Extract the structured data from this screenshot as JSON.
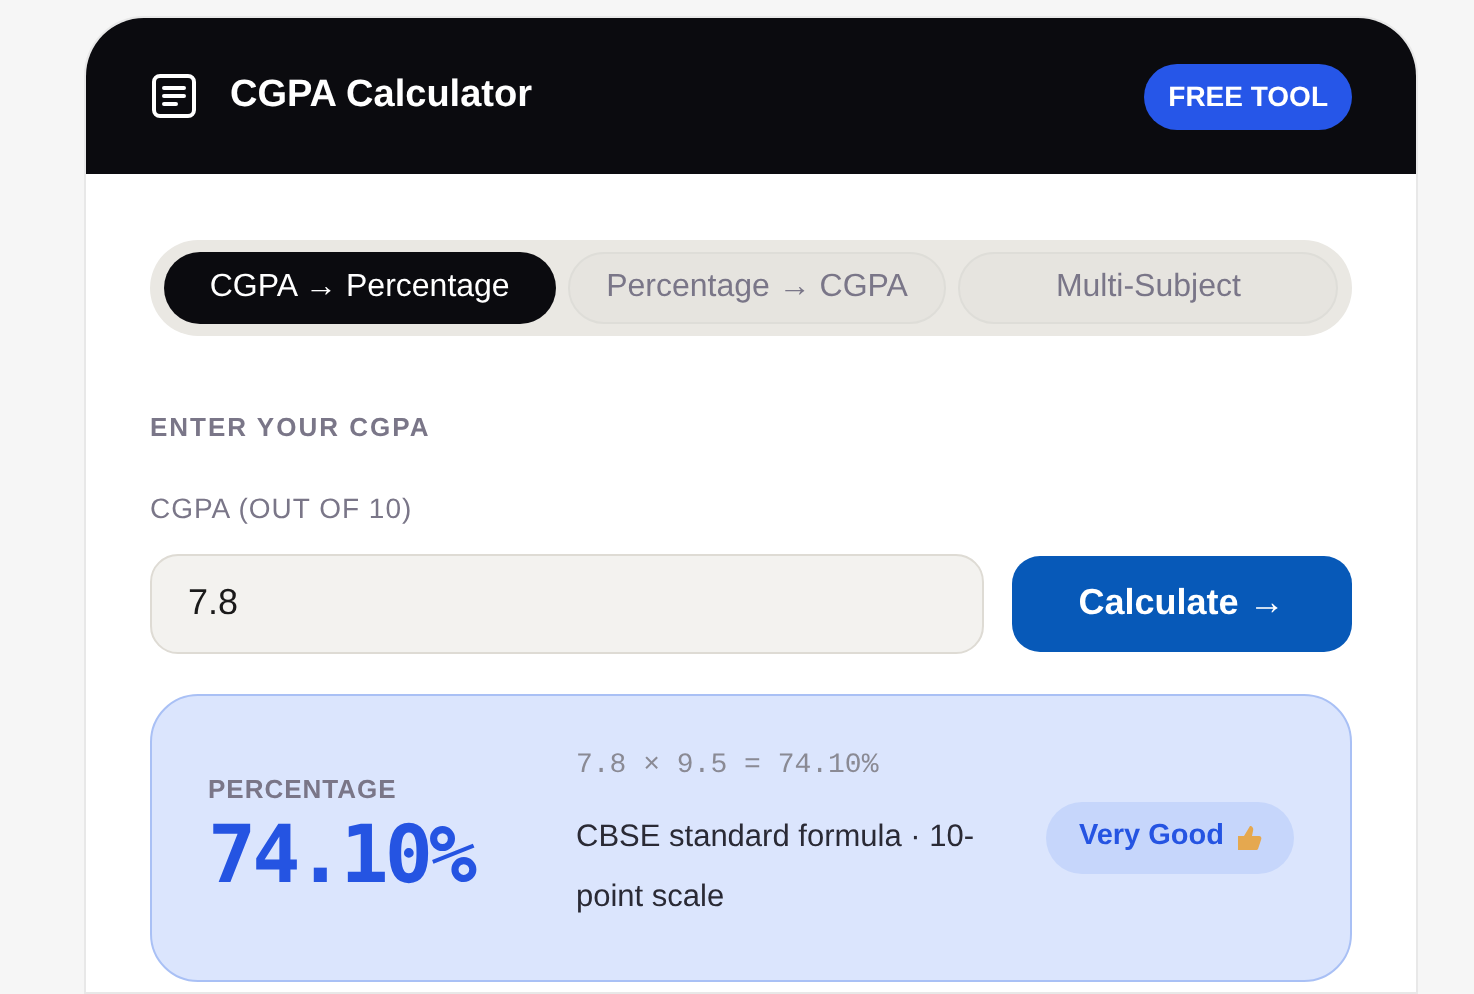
{
  "header": {
    "title": "CGPA Calculator",
    "badge": "FREE TOOL"
  },
  "tabs": [
    {
      "label": "CGPA → Percentage",
      "selected": true
    },
    {
      "label": "Percentage → CGPA",
      "selected": false
    },
    {
      "label": "Multi-Subject",
      "selected": false
    }
  ],
  "section_title": "ENTER YOUR CGPA",
  "field": {
    "label": "CGPA (OUT OF 10)",
    "value": "7.8"
  },
  "button": "Calculate →",
  "result": {
    "label": "PERCENTAGE",
    "value": "74.10%",
    "formula": "7.8 × 9.5 = 74.10%",
    "note": "CBSE standard formula · 10-point scale",
    "rating": "Very Good"
  }
}
